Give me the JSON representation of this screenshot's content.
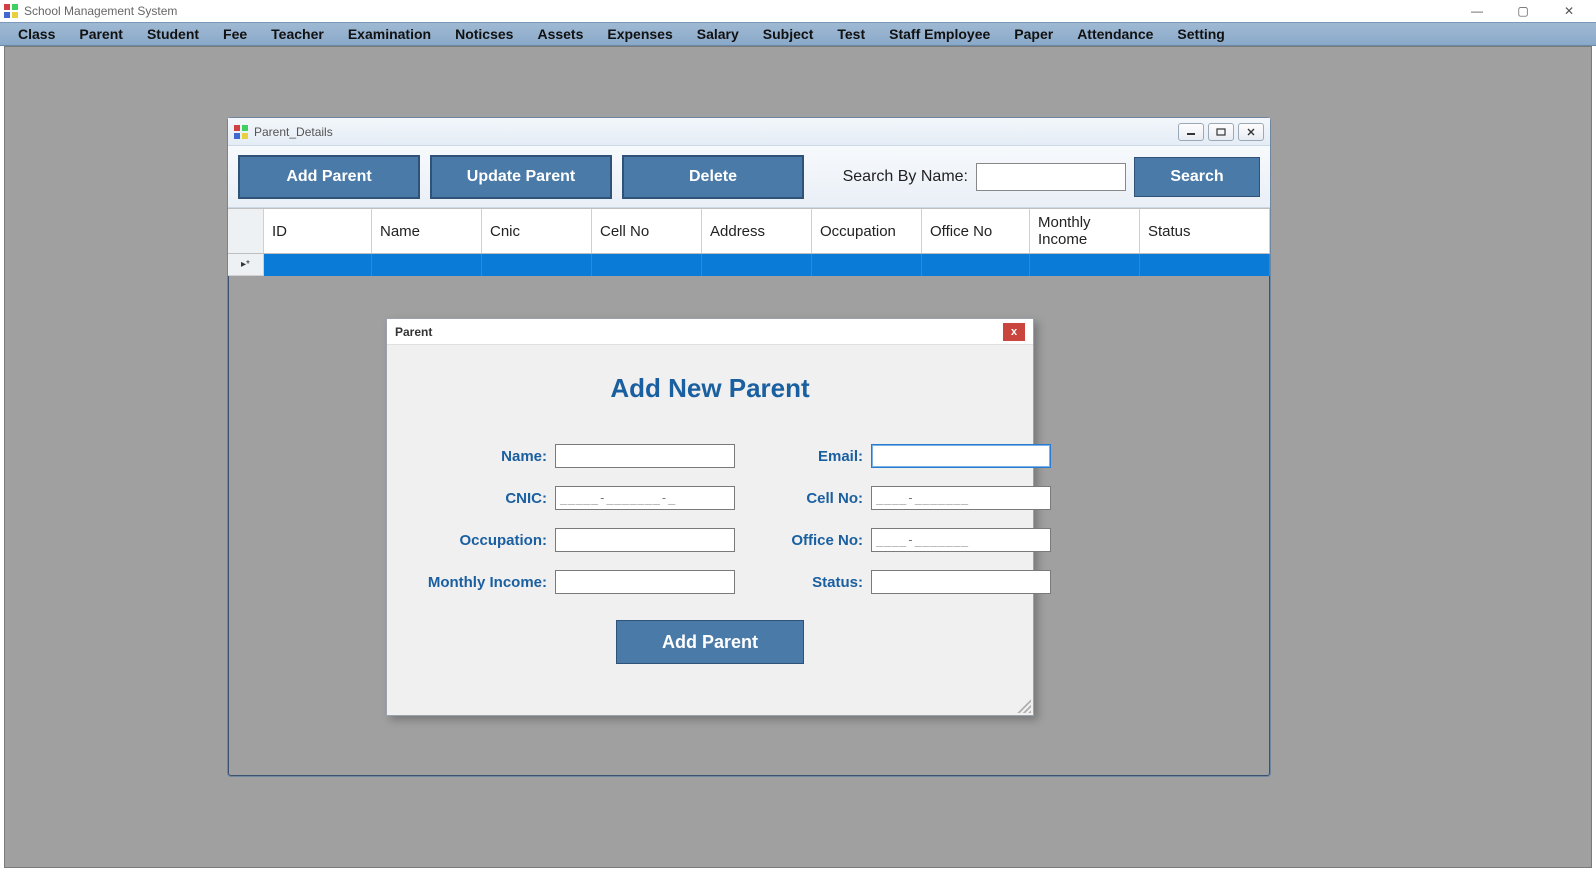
{
  "app": {
    "title": "School Management System"
  },
  "window_controls": {
    "min": "—",
    "max": "▢",
    "close": "✕"
  },
  "menubar": [
    "Class",
    "Parent",
    "Student",
    "Fee",
    "Teacher",
    "Examination",
    "Noticses",
    "Assets",
    "Expenses",
    "Salary",
    "Subject",
    "Test",
    "Staff Employee",
    "Paper",
    "Attendance",
    "Setting"
  ],
  "parent_details": {
    "title": "Parent_Details",
    "buttons": {
      "add": "Add Parent",
      "update": "Update Parent",
      "delete": "Delete",
      "search": "Search"
    },
    "search_label": "Search By Name:",
    "search_value": "",
    "columns": [
      "ID",
      "Name",
      "Cnic",
      "Cell No",
      "Address",
      "Occupation",
      "Office No",
      "Monthly Income",
      "Status"
    ]
  },
  "dialog": {
    "title": "Parent",
    "heading": "Add New Parent",
    "labels": {
      "name": "Name:",
      "email": "Email:",
      "cnic": "CNIC:",
      "cell": "Cell No:",
      "occupation": "Occupation:",
      "office": "Office No:",
      "income": "Monthly Income:",
      "status": "Status:"
    },
    "values": {
      "name": "",
      "email": "",
      "cnic_mask": "_____-_______-_",
      "cell_mask": "____-_______",
      "occupation": "",
      "office_mask": "____-_______",
      "income": "",
      "status": ""
    },
    "submit": "Add Parent"
  }
}
